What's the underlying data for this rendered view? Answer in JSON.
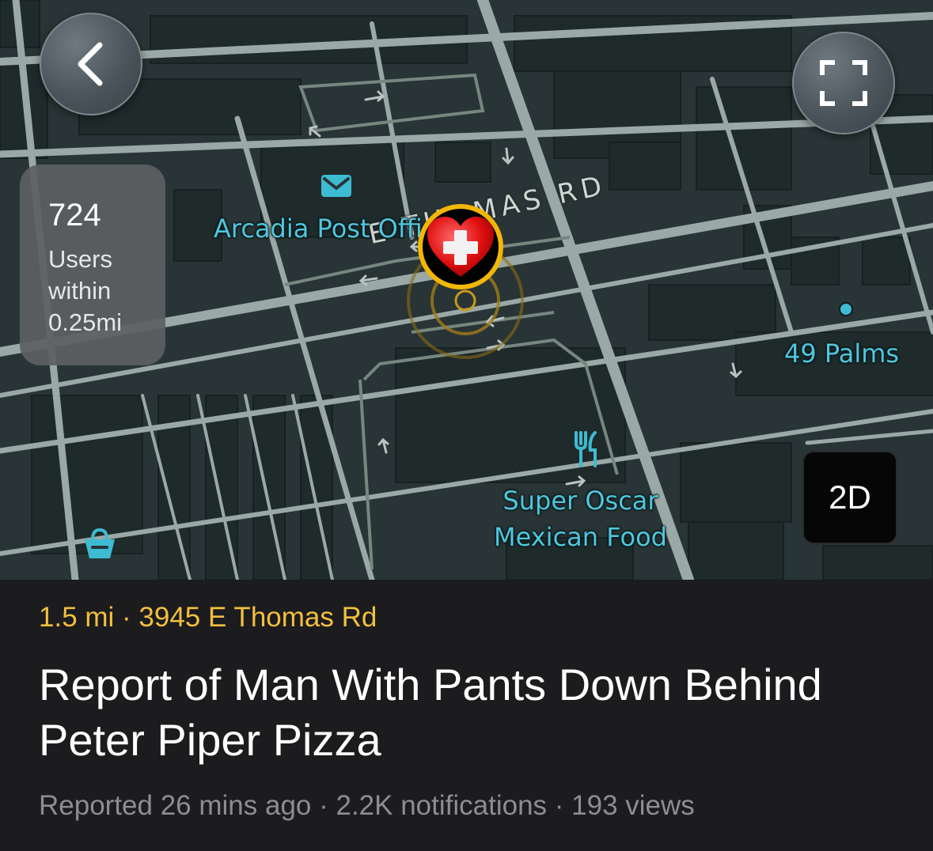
{
  "map": {
    "street_name": "E THOMAS RD",
    "places": [
      {
        "name": "Arcadia Post Office",
        "icon": "mail-icon"
      },
      {
        "name": "49 Palms",
        "icon": "dot-icon"
      },
      {
        "name": "Super Oscar\nMexican Food",
        "icon": "fork-knife-icon"
      },
      {
        "name": "",
        "icon": "shopping-basket-icon"
      }
    ],
    "incident_icon": "heart-plus-icon",
    "colors": {
      "background": "#283435",
      "road": "#9aa8a6",
      "building": "#1f2a2b",
      "label": "#4fc7dd",
      "pin_ring": "#f2b705"
    }
  },
  "controls": {
    "back_icon": "chevron-left-icon",
    "expand_icon": "expand-icon",
    "view_toggle_label": "2D"
  },
  "users_card": {
    "count": "724",
    "label": "Users within 0.25mi"
  },
  "incident": {
    "distance_address": "1.5 mi · 3945 E Thomas Rd",
    "title": "Report of Man With Pants Down Behind Peter Piper Pizza",
    "meta": "Reported 26 mins ago · 2.2K notifications · 193 views",
    "colors": {
      "distance": "#f3bf3f",
      "meta": "#8d8d92"
    }
  }
}
